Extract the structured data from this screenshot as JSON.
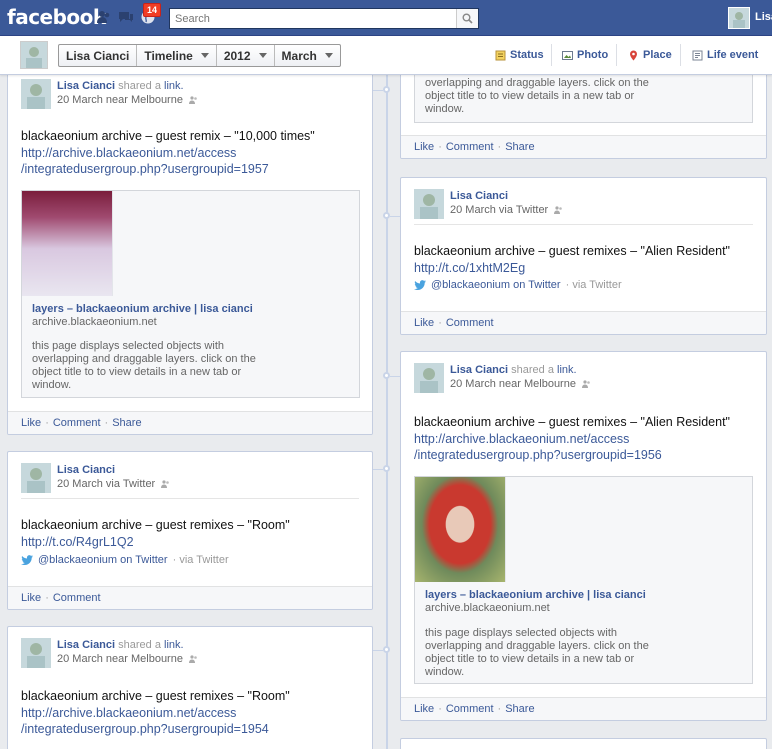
{
  "topbar": {
    "logo": "facebook",
    "notifications_count": "14",
    "search_placeholder": "Search",
    "user_name": "Lisa",
    "colors": {
      "brand": "#3b5998",
      "badge": "#f03d25"
    }
  },
  "timeline_header": {
    "name": "Lisa Cianci",
    "section": "Timeline",
    "year": "2012",
    "month": "March",
    "composer": {
      "status": "Status",
      "photo": "Photo",
      "place": "Place",
      "life_event": "Life event"
    }
  },
  "posts": {
    "left_1": {
      "author": "Lisa Cianci",
      "action": "shared a",
      "action_link": "link.",
      "meta": "20 March near Melbourne",
      "message": "blackaeonium archive – guest remix – \"10,000 times\"",
      "url_line1": "http://archive.blackaeonium.net/access",
      "url_line2": "/integratedusergroup.php?usergroupid=1957",
      "preview_title": "layers – blackaeonium archive | lisa cianci",
      "preview_domain": "archive.blackaeonium.net",
      "preview_desc": "this page displays selected objects with overlapping and draggable layers. click on the object title to to view details in a new tab or window.",
      "actions": [
        "Like",
        "Comment",
        "Share"
      ]
    },
    "left_2": {
      "author": "Lisa Cianci",
      "meta": "20 March via Twitter",
      "message": "blackaeonium archive – guest remixes – \"Room\"",
      "url": "http://t.co/R4grL1Q2",
      "via_handle": "@blackaeonium on Twitter",
      "via_suffix": "· via Twitter",
      "actions": [
        "Like",
        "Comment"
      ]
    },
    "left_3": {
      "author": "Lisa Cianci",
      "action": "shared a",
      "action_link": "link.",
      "meta": "20 March near Melbourne",
      "message": "blackaeonium archive – guest remixes – \"Room\"",
      "url_line1": "http://archive.blackaeonium.net/access",
      "url_line2": "/integratedusergroup.php?usergroupid=1954"
    },
    "right_0": {
      "preview_desc_tail": "overlapping and draggable layers. click on the object title to to view details in a new tab or window.",
      "actions": [
        "Like",
        "Comment",
        "Share"
      ]
    },
    "right_1": {
      "author": "Lisa Cianci",
      "meta": "20 March via Twitter",
      "message": "blackaeonium archive – guest remixes – \"Alien Resident\"",
      "url": "http://t.co/1xhtM2Eg",
      "via_handle": "@blackaeonium on Twitter",
      "via_suffix": "· via Twitter",
      "actions": [
        "Like",
        "Comment"
      ]
    },
    "right_2": {
      "author": "Lisa Cianci",
      "action": "shared a",
      "action_link": "link.",
      "meta": "20 March near Melbourne",
      "message": "blackaeonium archive – guest remixes – \"Alien Resident\"",
      "url_line1": "http://archive.blackaeonium.net/access",
      "url_line2": "/integratedusergroup.php?usergroupid=1956",
      "preview_title": "layers – blackaeonium archive | lisa cianci",
      "preview_domain": "archive.blackaeonium.net",
      "preview_desc": "this page displays selected objects with overlapping and draggable layers. click on the object title to to view details in a new tab or window.",
      "actions": [
        "Like",
        "Comment",
        "Share"
      ]
    }
  }
}
